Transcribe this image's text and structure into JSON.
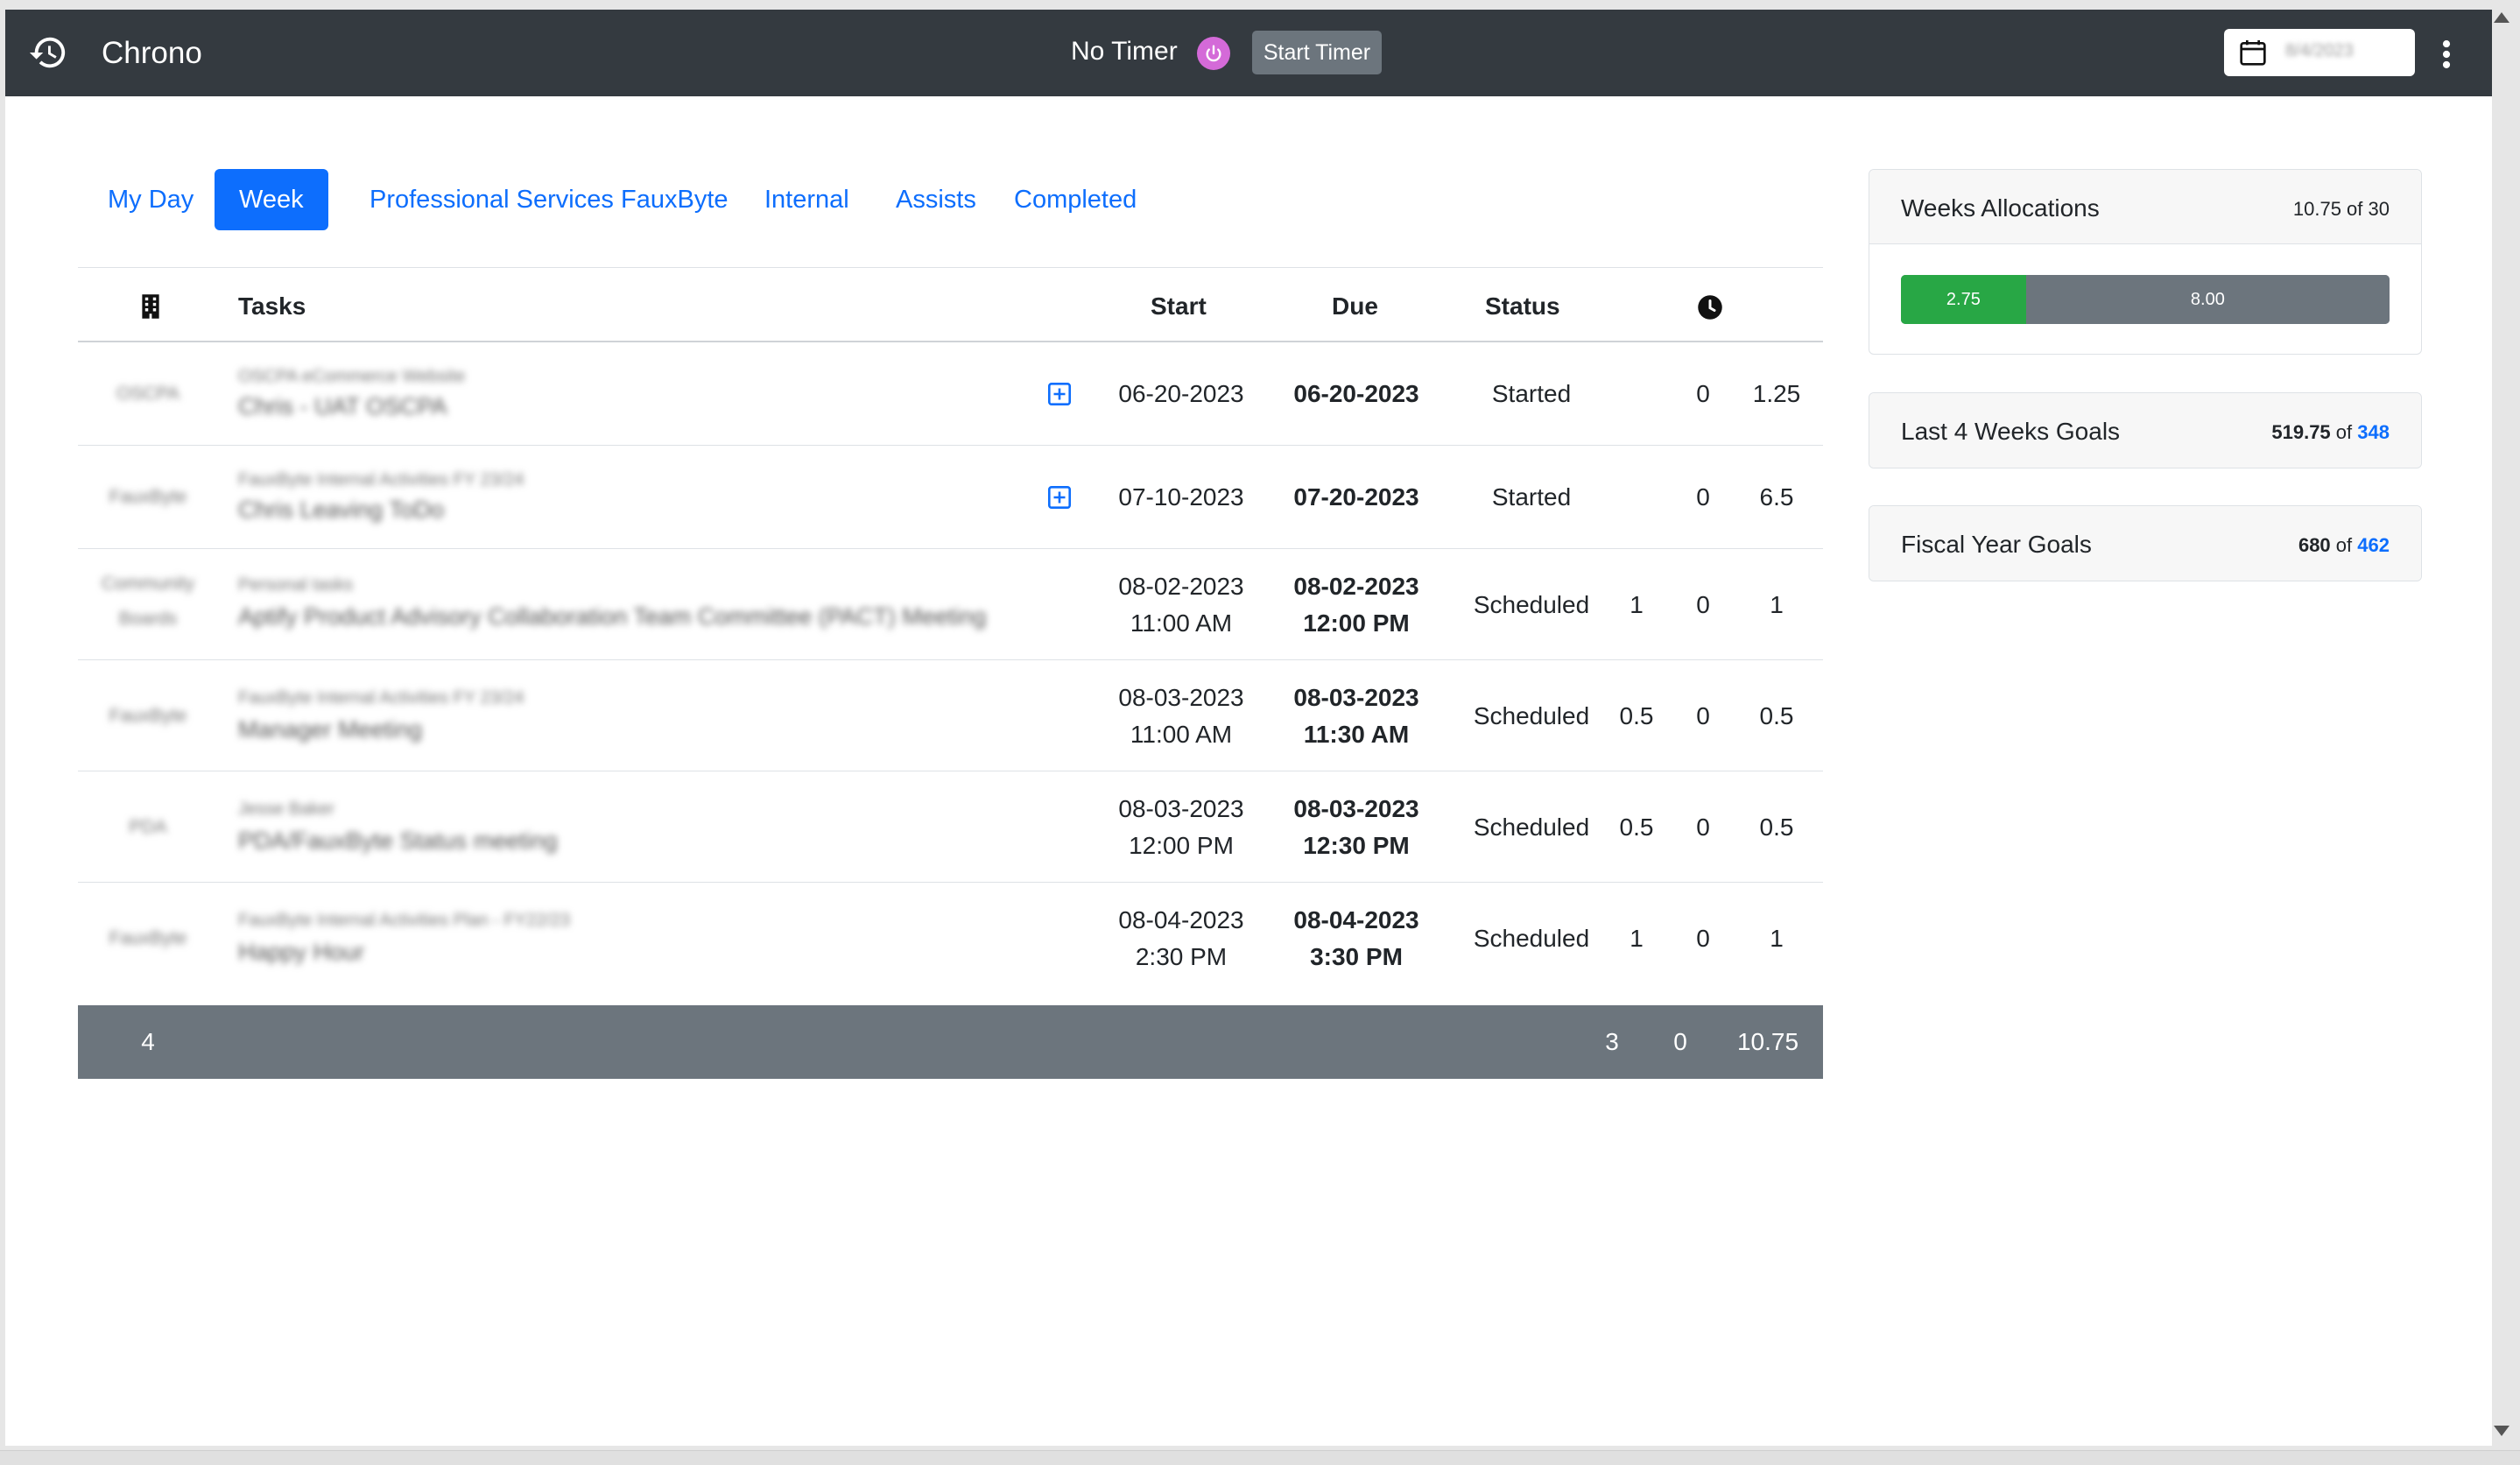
{
  "header": {
    "brand": "Chrono",
    "timer_status": "No Timer",
    "start_timer_label": "Start Timer",
    "date_value": "8/4/2023",
    "icons": [
      "history-icon",
      "power-icon",
      "calendar-icon",
      "kebab-menu-icon"
    ],
    "colors": {
      "navbar": "#343a40",
      "power": "#d46ad8"
    }
  },
  "tabs": [
    {
      "label": "My Day"
    },
    {
      "label": "Week",
      "active": true
    },
    {
      "label": "Professional Services"
    },
    {
      "label": "FauxByte"
    },
    {
      "label": "Internal"
    },
    {
      "label": "Assists"
    },
    {
      "label": "Completed"
    }
  ],
  "table": {
    "headers": {
      "client_icon": "building-icon",
      "tasks": "Tasks",
      "start": "Start",
      "due": "Due",
      "status": "Status",
      "time_icon": "clock-icon"
    },
    "rows": [
      {
        "client": "OSCPA",
        "project": "OSCPA eCommerce Website",
        "task": "Chris - UAT OSCPA",
        "has_add": true,
        "start": "06-20-2023",
        "start_time": "",
        "due": "06-20-2023",
        "due_time": "",
        "status": "Started",
        "allocated": "",
        "spent": "0",
        "total": "1.25"
      },
      {
        "client": "FauxByte",
        "project": "FauxByte Internal Activities FY 23/24",
        "task": "Chris Leaving ToDo",
        "has_add": true,
        "start": "07-10-2023",
        "start_time": "",
        "due": "07-20-2023",
        "due_time": "",
        "status": "Started",
        "allocated": "",
        "spent": "0",
        "total": "6.5"
      },
      {
        "client": "Community Boards",
        "project": "Personal tasks",
        "task": "Aptify Product Advisory Collaboration Team Committee (PACT) Meeting",
        "has_add": false,
        "start": "08-02-2023",
        "start_time": "11:00 AM",
        "due": "08-02-2023",
        "due_time": "12:00 PM",
        "status": "Scheduled",
        "allocated": "1",
        "spent": "0",
        "total": "1"
      },
      {
        "client": "FauxByte",
        "project": "FauxByte Internal Activities FY 23/24",
        "task": "Manager Meeting",
        "has_add": false,
        "start": "08-03-2023",
        "start_time": "11:00 AM",
        "due": "08-03-2023",
        "due_time": "11:30 AM",
        "status": "Scheduled",
        "allocated": "0.5",
        "spent": "0",
        "total": "0.5"
      },
      {
        "client": "PDA",
        "project": "Jesse Baker",
        "task": "PDA/FauxByte Status meeting",
        "has_add": false,
        "start": "08-03-2023",
        "start_time": "12:00 PM",
        "due": "08-03-2023",
        "due_time": "12:30 PM",
        "status": "Scheduled",
        "allocated": "0.5",
        "spent": "0",
        "total": "0.5"
      },
      {
        "client": "FauxByte",
        "project": "FauxByte Internal Activities Plan - FY22/23",
        "task": "Happy Hour",
        "has_add": false,
        "start": "08-04-2023",
        "start_time": "2:30 PM",
        "due": "08-04-2023",
        "due_time": "3:30 PM",
        "status": "Scheduled",
        "allocated": "1",
        "spent": "0",
        "total": "1"
      }
    ],
    "footer": {
      "count": "4",
      "allocated": "3",
      "spent": "0",
      "total": "10.75"
    }
  },
  "cards": {
    "weeks": {
      "title": "Weeks Allocations",
      "value": "10.75 of 30",
      "bar_green": "2.75",
      "bar_gray": "8.00",
      "green_fraction": 0.2558
    },
    "last4": {
      "title": "Last 4 Weeks Goals",
      "value_main": "519.75",
      "of": "of",
      "value_target": "348"
    },
    "fiscal": {
      "title": "Fiscal Year Goals",
      "value_main": "680",
      "of": "of",
      "value_target": "462"
    }
  }
}
